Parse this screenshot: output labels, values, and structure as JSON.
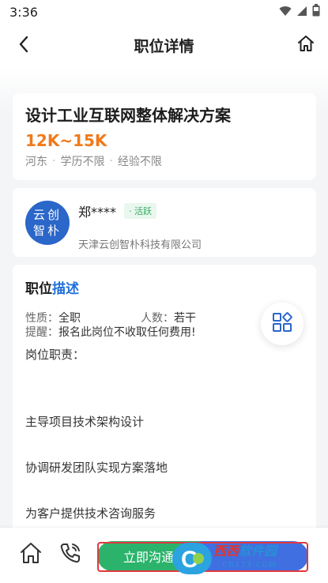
{
  "status_bar": {
    "time": "3:36"
  },
  "header": {
    "title": "职位详情"
  },
  "job": {
    "title": "设计工业互联网整体解决方案",
    "salary": "12K~15K",
    "tags": [
      "河东",
      "学历不限",
      "经验不限"
    ]
  },
  "company": {
    "logo_line1": "云创",
    "logo_line2": "智朴",
    "contact": "郑****",
    "badge": "活跃",
    "name": "天津云创智朴科技有限公司"
  },
  "description": {
    "title_part1": "职位",
    "title_part2": "描述",
    "nature_label": "性质：",
    "nature_value": "全职",
    "count_label": "人数：",
    "count_value": "若干",
    "reminder_label": "提醒：",
    "reminder_value": "报名此岗位不收取任何费用!",
    "duty_label": "岗位职责：",
    "duties": [
      "主导项目技术架构设计",
      "协调研发团队实现方案落地",
      "为客户提供技术咨询服务"
    ]
  },
  "bottom_bar": {
    "chat_label": "立即沟通"
  },
  "watermark": {
    "main_part1": "西西",
    "main_part2": "软件园",
    "sub": "CR173.COM"
  },
  "icons": {
    "back": "back-arrow-icon",
    "home": "home-icon",
    "grid": "grid-apps-icon",
    "phone": "phone-icon",
    "wifi": "wifi-icon",
    "signal": "signal-icon",
    "battery": "battery-icon"
  },
  "colors": {
    "salary": "#f07a1a",
    "accent_blue": "#1f6fd9",
    "chat_green": "#2bb36b",
    "apply_blue": "#3f6fe0",
    "logo_blue": "#2b66c9"
  }
}
